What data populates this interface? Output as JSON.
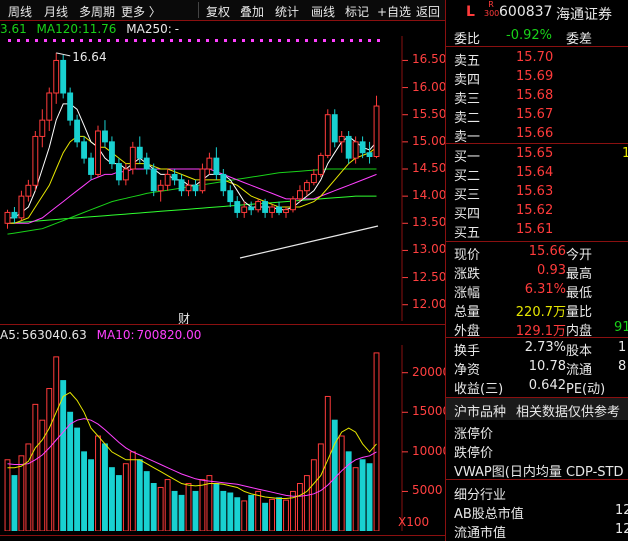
{
  "toolbar": {
    "items": [
      "周线",
      "月线",
      "多周期",
      "更多 〉",
      "复权",
      "叠加",
      "统计",
      "画线",
      "标记",
      "+自选",
      "返回"
    ]
  },
  "kline": {
    "ma_legend": {
      "ma60": "3.61",
      "ma120_label": "MA120:",
      "ma120_value": "11.76",
      "ma250_label": "MA250:",
      "ma250_value": "-"
    },
    "high_marker": "16.64",
    "y_ticks": [
      "16.50",
      "16.00",
      "15.50",
      "15.00",
      "14.50",
      "14.00",
      "13.50",
      "13.00",
      "12.50",
      "12.00"
    ],
    "y_tick_values": [
      16.5,
      16.0,
      15.5,
      15.0,
      14.5,
      14.0,
      13.5,
      13.0,
      12.5,
      12.0
    ],
    "ylim": [
      11.7,
      16.95
    ],
    "finance_marker": "财",
    "candles": [
      [
        13.5,
        13.75,
        13.4,
        13.7
      ],
      [
        13.7,
        13.8,
        13.5,
        13.6
      ],
      [
        13.6,
        14.1,
        13.55,
        14.0
      ],
      [
        14.0,
        14.3,
        13.9,
        14.2
      ],
      [
        14.2,
        15.2,
        14.1,
        15.1
      ],
      [
        15.1,
        15.6,
        14.9,
        15.4
      ],
      [
        15.4,
        16.0,
        15.2,
        15.9
      ],
      [
        15.9,
        16.64,
        15.7,
        16.5
      ],
      [
        16.5,
        16.6,
        15.8,
        15.9
      ],
      [
        15.9,
        16.0,
        15.3,
        15.4
      ],
      [
        15.4,
        15.5,
        14.9,
        15.0
      ],
      [
        15.0,
        15.1,
        14.6,
        14.7
      ],
      [
        14.7,
        14.8,
        14.3,
        14.4
      ],
      [
        14.4,
        15.3,
        14.35,
        15.2
      ],
      [
        15.2,
        15.4,
        14.9,
        15.0
      ],
      [
        15.0,
        15.1,
        14.5,
        14.6
      ],
      [
        14.6,
        14.7,
        14.2,
        14.3
      ],
      [
        14.3,
        14.6,
        14.2,
        14.5
      ],
      [
        14.5,
        15.0,
        14.4,
        14.9
      ],
      [
        14.9,
        15.1,
        14.6,
        14.7
      ],
      [
        14.7,
        14.8,
        14.4,
        14.5
      ],
      [
        14.5,
        14.6,
        14.0,
        14.1
      ],
      [
        14.1,
        14.3,
        13.9,
        14.2
      ],
      [
        14.2,
        14.5,
        14.1,
        14.4
      ],
      [
        14.4,
        14.5,
        14.2,
        14.3
      ],
      [
        14.3,
        14.4,
        14.0,
        14.1
      ],
      [
        14.1,
        14.3,
        14.0,
        14.2
      ],
      [
        14.2,
        14.3,
        14.0,
        14.1
      ],
      [
        14.1,
        14.6,
        14.05,
        14.5
      ],
      [
        14.5,
        14.8,
        14.4,
        14.7
      ],
      [
        14.7,
        14.9,
        14.3,
        14.4
      ],
      [
        14.4,
        14.5,
        14.0,
        14.1
      ],
      [
        14.1,
        14.2,
        13.8,
        13.9
      ],
      [
        13.9,
        14.0,
        13.6,
        13.7
      ],
      [
        13.7,
        13.9,
        13.6,
        13.8
      ],
      [
        13.8,
        13.9,
        13.65,
        13.75
      ],
      [
        13.75,
        13.95,
        13.7,
        13.9
      ],
      [
        13.9,
        13.95,
        13.6,
        13.7
      ],
      [
        13.7,
        13.85,
        13.6,
        13.8
      ],
      [
        13.8,
        13.9,
        13.65,
        13.7
      ],
      [
        13.7,
        13.8,
        13.6,
        13.75
      ],
      [
        13.75,
        14.0,
        13.7,
        13.95
      ],
      [
        13.95,
        14.2,
        13.9,
        14.1
      ],
      [
        14.1,
        14.3,
        14.0,
        14.25
      ],
      [
        14.25,
        14.5,
        14.2,
        14.4
      ],
      [
        14.4,
        14.8,
        14.35,
        14.75
      ],
      [
        14.75,
        15.6,
        14.7,
        15.5
      ],
      [
        15.5,
        15.6,
        14.9,
        15.0
      ],
      [
        15.0,
        15.2,
        14.8,
        15.1
      ],
      [
        15.1,
        15.2,
        14.6,
        14.7
      ],
      [
        14.7,
        15.1,
        14.6,
        15.0
      ],
      [
        15.0,
        15.1,
        14.7,
        14.8
      ],
      [
        14.8,
        15.0,
        14.6,
        14.73
      ],
      [
        14.73,
        15.85,
        14.7,
        15.66
      ]
    ],
    "ma5": [
      13.6,
      13.6,
      13.7,
      13.8,
      14.1,
      14.5,
      14.9,
      15.4,
      15.7,
      15.7,
      15.6,
      15.3,
      15.0,
      14.9,
      14.7,
      14.6,
      14.6,
      14.5,
      14.6,
      14.7,
      14.6,
      14.5,
      14.4,
      14.4,
      14.3,
      14.3,
      14.2,
      14.2,
      14.3,
      14.4,
      14.4,
      14.4,
      14.3,
      14.1,
      13.9,
      13.8,
      13.8,
      13.8,
      13.8,
      13.75,
      13.75,
      13.8,
      13.9,
      14.0,
      14.1,
      14.3,
      14.6,
      14.8,
      15.0,
      15.1,
      15.0,
      14.9,
      14.85,
      15.0
    ],
    "ma10": [
      13.5,
      13.5,
      13.55,
      13.6,
      13.8,
      14.0,
      14.2,
      14.5,
      14.8,
      15.0,
      15.1,
      15.1,
      15.0,
      14.9,
      14.9,
      14.8,
      14.7,
      14.6,
      14.6,
      14.6,
      14.6,
      14.55,
      14.5,
      14.5,
      14.45,
      14.4,
      14.35,
      14.3,
      14.3,
      14.3,
      14.3,
      14.3,
      14.25,
      14.2,
      14.1,
      14.0,
      13.95,
      13.9,
      13.85,
      13.8,
      13.8,
      13.8,
      13.8,
      13.85,
      13.9,
      14.0,
      14.15,
      14.3,
      14.45,
      14.6,
      14.7,
      14.75,
      14.8,
      14.9
    ],
    "ma20": [
      13.5,
      13.5,
      13.5,
      13.5,
      13.55,
      13.6,
      13.7,
      13.8,
      13.9,
      14.0,
      14.1,
      14.2,
      14.3,
      14.35,
      14.4,
      14.4,
      14.45,
      14.45,
      14.5,
      14.5,
      14.5,
      14.5,
      14.5,
      14.5,
      14.5,
      14.5,
      14.5,
      14.5,
      14.5,
      14.5,
      14.45,
      14.4,
      14.35,
      14.3,
      14.25,
      14.2,
      14.15,
      14.1,
      14.05,
      14.0,
      13.95,
      13.95,
      13.95,
      13.95,
      13.95,
      14.0,
      14.05,
      14.1,
      14.15,
      14.2,
      14.25,
      14.3,
      14.35,
      14.4
    ],
    "ma60": [
      13.3,
      13.32,
      13.34,
      13.36,
      13.38,
      13.4,
      13.45,
      13.5,
      13.55,
      13.6,
      13.65,
      13.7,
      13.75,
      13.8,
      13.85,
      13.9,
      13.93,
      13.96,
      13.99,
      14.02,
      14.05,
      14.07,
      14.09,
      14.11,
      14.13,
      14.15,
      14.17,
      14.19,
      14.21,
      14.23,
      14.25,
      14.27,
      14.29,
      14.31,
      14.33,
      14.35,
      14.37,
      14.39,
      14.41,
      14.43,
      14.44,
      14.45,
      14.46,
      14.47,
      14.48,
      14.49,
      14.5,
      14.5,
      14.5,
      14.5,
      14.5,
      14.5,
      14.5,
      14.5
    ],
    "ma120": [
      13.5,
      13.51,
      13.52,
      13.53,
      13.54,
      13.55,
      13.56,
      13.57,
      13.58,
      13.59,
      13.6,
      13.61,
      13.62,
      13.63,
      13.64,
      13.65,
      13.66,
      13.67,
      13.68,
      13.69,
      13.7,
      13.71,
      13.72,
      13.73,
      13.74,
      13.75,
      13.76,
      13.77,
      13.78,
      13.79,
      13.8,
      13.81,
      13.82,
      13.83,
      13.84,
      13.85,
      13.86,
      13.87,
      13.88,
      13.89,
      13.9,
      13.91,
      13.92,
      13.93,
      13.94,
      13.95,
      13.96,
      13.97,
      13.98,
      13.99,
      14.0,
      14.0,
      14.0,
      14.0
    ]
  },
  "volume": {
    "legend": {
      "ma5_label": "A5:",
      "ma5_value": "563040.63",
      "ma10_label": "MA10:",
      "ma10_value": "700820.00"
    },
    "y_ticks": [
      "20000",
      "15000",
      "10000",
      "5000"
    ],
    "y_tick_values": [
      20000,
      15000,
      10000,
      5000
    ],
    "ylim": [
      0,
      23500
    ],
    "unit": "X100",
    "bars": [
      9000,
      7000,
      9500,
      11000,
      16000,
      14000,
      18000,
      22000,
      19000,
      15000,
      13000,
      10000,
      9000,
      12000,
      11000,
      8000,
      7000,
      8500,
      10000,
      9000,
      7500,
      6000,
      5500,
      6500,
      5000,
      4500,
      6000,
      5000,
      6500,
      7000,
      6000,
      5000,
      4800,
      4200,
      3800,
      4500,
      5000,
      3500,
      4000,
      4200,
      3900,
      5000,
      6000,
      7000,
      9000,
      11000,
      17000,
      14000,
      12000,
      10000,
      8000,
      9000,
      8500,
      22500
    ],
    "vma5": [
      8000,
      8000,
      8200,
      8800,
      10500,
      11500,
      13000,
      15000,
      17000,
      17500,
      16500,
      15000,
      13000,
      12000,
      11000,
      10000,
      9500,
      9000,
      9000,
      9000,
      8500,
      8000,
      7500,
      7000,
      6500,
      6000,
      5800,
      5700,
      5800,
      6000,
      6000,
      5900,
      5700,
      5500,
      5000,
      4700,
      4500,
      4300,
      4200,
      4100,
      4100,
      4200,
      4500,
      5000,
      6000,
      7000,
      9000,
      11000,
      12500,
      13000,
      12500,
      11000,
      10000,
      11000
    ],
    "vma10": [
      8500,
      8400,
      8400,
      8500,
      9000,
      9600,
      10500,
      11500,
      12500,
      13500,
      14000,
      14200,
      14000,
      13500,
      12800,
      12000,
      11200,
      10500,
      10000,
      9600,
      9200,
      8800,
      8400,
      8000,
      7600,
      7200,
      6900,
      6600,
      6400,
      6300,
      6200,
      6100,
      6000,
      5900,
      5700,
      5500,
      5300,
      5100,
      4900,
      4700,
      4500,
      4400,
      4400,
      4500,
      4700,
      5100,
      5800,
      6700,
      7600,
      8400,
      9000,
      9300,
      9500,
      10000
    ]
  },
  "panel": {
    "market_letter": "L",
    "badge_top": "R",
    "badge_bottom": "300",
    "code": "600837",
    "name": "海通证券",
    "weibi_label": "委比",
    "weibi_value": "-0.92%",
    "weicha_label": "委差",
    "asks": [
      {
        "label": "卖五",
        "price": "15.70"
      },
      {
        "label": "卖四",
        "price": "15.69"
      },
      {
        "label": "卖三",
        "price": "15.68"
      },
      {
        "label": "卖二",
        "price": "15.67"
      },
      {
        "label": "卖一",
        "price": "15.66"
      }
    ],
    "bids": [
      {
        "label": "买一",
        "price": "15.65"
      },
      {
        "label": "买二",
        "price": "15.64"
      },
      {
        "label": "买三",
        "price": "15.63"
      },
      {
        "label": "买四",
        "price": "15.62"
      },
      {
        "label": "买五",
        "price": "15.61"
      }
    ],
    "bid1_volume_partial": "1",
    "quote": [
      {
        "l": "现价",
        "v": "15.66",
        "r": "今开"
      },
      {
        "l": "涨跌",
        "v": "0.93",
        "r": "最高"
      },
      {
        "l": "涨幅",
        "v": "6.31%",
        "r": "最低"
      },
      {
        "l": "总量",
        "v": "220.7万",
        "r": "量比"
      },
      {
        "l": "外盘",
        "v": "129.1万",
        "r": "内盘",
        "rv": "91"
      }
    ],
    "finance": [
      {
        "l": "换手",
        "v": "2.73%",
        "r": "股本",
        "rv": "1"
      },
      {
        "l": "净资",
        "v": "10.78",
        "r": "流通",
        "rv": "8"
      },
      {
        "l": "收益(三)",
        "v": "0.642",
        "r": "PE(动)"
      }
    ],
    "section_title_a": "沪市品种",
    "section_title_b": "相关数据仅供参考",
    "limit_up_label": "涨停价",
    "limit_down_label": "跌停价",
    "vwap_label": "VWAP图(日内均量 CDP-STD",
    "industry_label": "细分行业",
    "ab_label": "AB股总市值",
    "ab_value_partial": "12",
    "float_label": "流通市值",
    "float_value_partial": "12"
  },
  "colors": {
    "up": "#ff3b3b",
    "down": "#19d1d1",
    "ma5": "#ffffff",
    "ma10": "#e6e600",
    "ma20": "#ff40ff",
    "ma60": "#19d119",
    "ma120": "#30ff30",
    "grid": "#8a1010"
  }
}
